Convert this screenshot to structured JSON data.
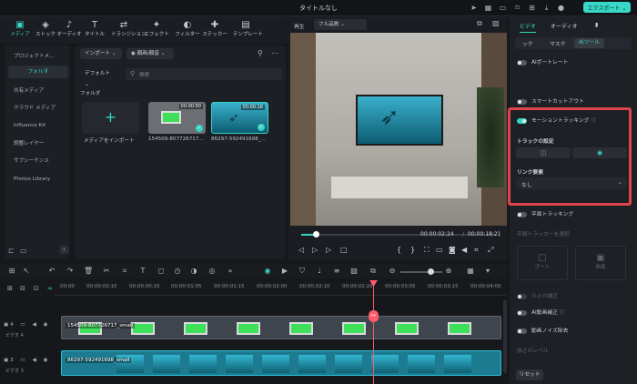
{
  "window": {
    "title": "タイトルなし",
    "export_label": "エクスポート ⌄"
  },
  "toolbar": {
    "items": [
      {
        "icon": "media",
        "label": "メディア"
      },
      {
        "icon": "stock",
        "label": "ストック"
      },
      {
        "icon": "audio",
        "label": "オーディオ"
      },
      {
        "icon": "title",
        "label": "タイトル"
      },
      {
        "icon": "transition",
        "label": "トランジション"
      },
      {
        "icon": "effect",
        "label": "エフェクト"
      },
      {
        "icon": "filter",
        "label": "フィルター"
      },
      {
        "icon": "sticker",
        "label": "ステッカー"
      },
      {
        "icon": "template",
        "label": "テンプレート"
      }
    ]
  },
  "sidebar": {
    "items": [
      "プロジェクトメ...",
      "フォルダ",
      "共有メディア",
      "クラウド メディア",
      "Influence Kit",
      "調整レイヤー",
      "サブシーケンス",
      "Photos Library"
    ]
  },
  "media": {
    "import_label": "インポート",
    "dropdown_label": "顔画/顔音",
    "sort_label": "デフォルト",
    "search_placeholder": "検索",
    "folder_label": "フォルダ",
    "import_tile_label": "メディアをインポート",
    "clips": [
      {
        "name": "154509-807726717...",
        "duration": "00:00:50"
      },
      {
        "name": "86297-592491698_...",
        "duration": "00:00:18"
      }
    ]
  },
  "preview": {
    "label": "再生",
    "quality": "フル品質",
    "current_time": "00:00:02:24",
    "separator": "/",
    "total_time": "00:00:18:21"
  },
  "right_panel": {
    "tabs": [
      "ビデオ",
      "オーディオ"
    ],
    "subtabs": [
      "ック",
      "マスク",
      "AIツール"
    ],
    "rows": {
      "ai_portrait": "AIポートレート",
      "smart_cutout": "スマートカットアウト",
      "motion_tracking": "モーショントラッキング",
      "track_settings": "トラックの設定",
      "link_element": "リンク要素",
      "link_value": "なし",
      "planar_tracking": "平面トラッキング",
      "planar_hint": "平面トラッカーを選択",
      "ai_audio": "AI動画補正",
      "denoise": "動画ノイズ除去",
      "reset": "リセット",
      "faint1": "ポート",
      "faint2": "画面",
      "faint3": "の上の補正",
      "faint4": "強さのレベル"
    }
  },
  "timeline": {
    "ticks": [
      "00:00",
      "00:00:00:10",
      "00:00:00:20",
      "00:00:01:05",
      "00:00:01:15",
      "00:00:02:00",
      "00:00:02:10",
      "00:00:02:20",
      "00:00:03:05",
      "00:00:03:15",
      "00:00:04:00"
    ],
    "tracks": [
      {
        "num": "4",
        "name": "ビデオ 4",
        "clip": "154509-807726717_small"
      },
      {
        "num": "3",
        "name": "ビデオ 3",
        "clip": "86297-592491698_small"
      }
    ]
  },
  "colors": {
    "accent": "#37d4c5",
    "highlight_border": "#e0454d"
  }
}
